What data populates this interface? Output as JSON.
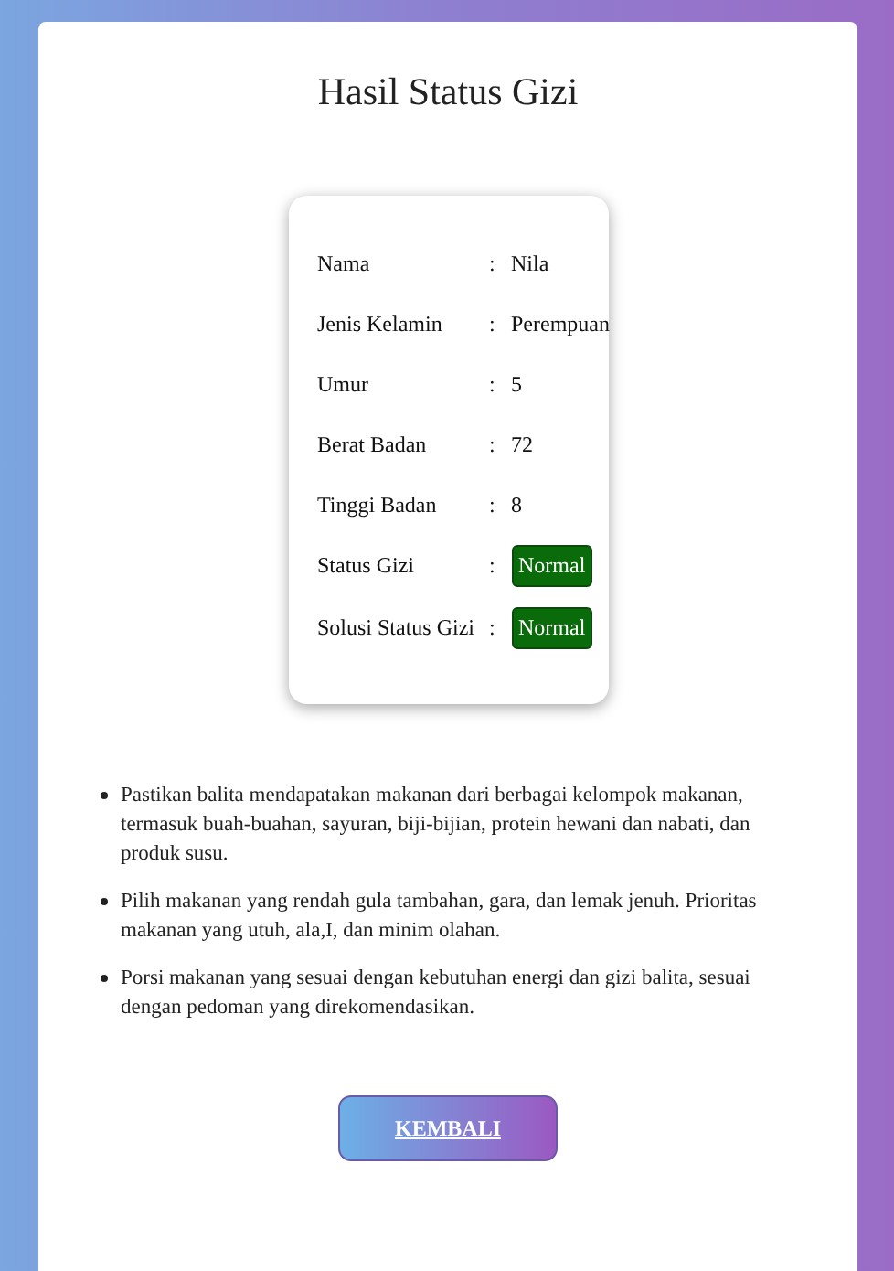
{
  "title": "Hasil Status Gizi",
  "fields": [
    {
      "label": "Nama",
      "value": "Nila",
      "kind": "text"
    },
    {
      "label": "Jenis Kelamin",
      "value": "Perempuan",
      "kind": "text"
    },
    {
      "label": "Umur",
      "value": "5",
      "kind": "text"
    },
    {
      "label": "Berat Badan",
      "value": "72",
      "kind": "text"
    },
    {
      "label": "Tinggi Badan",
      "value": "8",
      "kind": "text"
    },
    {
      "label": "Status Gizi",
      "value": "Normal",
      "kind": "badge"
    },
    {
      "label": "Solusi Status Gizi",
      "value": "Normal",
      "kind": "badge"
    }
  ],
  "separator": ":",
  "recommendations": [
    "Pastikan balita mendapatakan makanan dari berbagai kelompok makanan, termasuk buah-buahan, sayuran, biji-bijian, protein hewani dan nabati, dan produk susu.",
    "Pilih makanan yang rendah gula tambahan, gara, dan lemak jenuh. Prioritas makanan yang utuh, ala,I, dan minim olahan.",
    "Porsi makanan yang sesuai dengan kebutuhan energi dan gizi balita, sesuai dengan pedoman yang direkomendasikan."
  ],
  "button": "KEMBALI"
}
